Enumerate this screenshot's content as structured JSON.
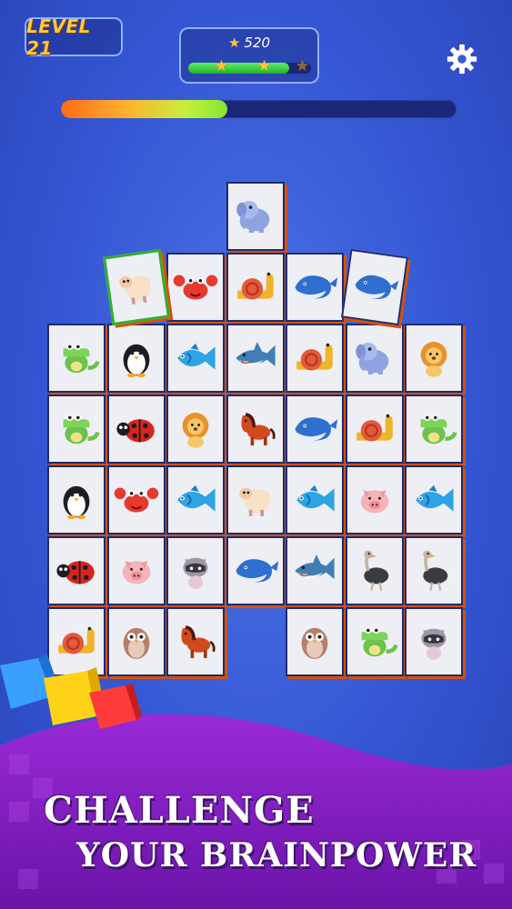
{
  "hud": {
    "level_label": "LEVEL 21",
    "score": "520",
    "star_progress": 0.82,
    "stars_earned": 2,
    "stars_total": 3,
    "level_progress": 0.42
  },
  "board": {
    "rows": [
      [
        "",
        "",
        "",
        "elephant",
        "",
        "",
        ""
      ],
      [
        "",
        "sheep",
        "crab",
        "snail",
        "whale",
        "whale",
        ""
      ],
      [
        "crocodile",
        "penguin",
        "fish",
        "shark",
        "snail",
        "elephant",
        "lion"
      ],
      [
        "crocodile",
        "ladybug",
        "lion",
        "horse",
        "whale",
        "snail",
        "crocodile"
      ],
      [
        "penguin",
        "crab",
        "fish",
        "sheep",
        "fish",
        "pig",
        "fish"
      ],
      [
        "ladybug",
        "pig",
        "raccoon",
        "whale",
        "shark",
        "ostrich",
        "ostrich"
      ],
      [
        "snail",
        "owl",
        "horse",
        "",
        "owl",
        "crocodile",
        "raccoon"
      ]
    ],
    "selected_tile": "sheep"
  },
  "promo": {
    "line1": "CHALLENGE",
    "line2": "YOUR BRAINPOWER"
  },
  "colors": {
    "background": "#3557d4",
    "accent_gold": "#ffc93a",
    "tile_side": "#e85e12",
    "wave_purple": "#8a1fc9"
  },
  "icons": {
    "settings": "gear-icon",
    "score": "star-icon"
  }
}
